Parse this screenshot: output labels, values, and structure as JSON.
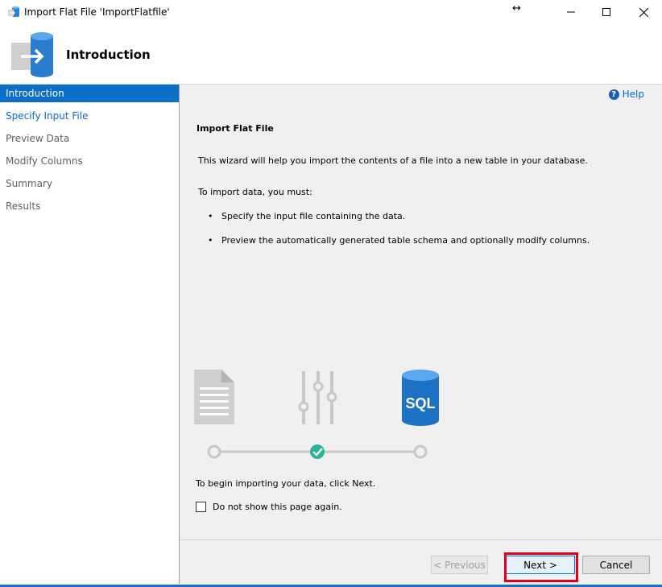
{
  "window": {
    "title": "Import Flat File 'ImportFlatfile'",
    "resize_glyph": "↔"
  },
  "header": {
    "title": "Introduction"
  },
  "nav": {
    "items": [
      {
        "label": "Introduction",
        "state": "active"
      },
      {
        "label": "Specify Input File",
        "state": "link"
      },
      {
        "label": "Preview Data",
        "state": "disabled"
      },
      {
        "label": "Modify Columns",
        "state": "disabled"
      },
      {
        "label": "Summary",
        "state": "disabled"
      },
      {
        "label": "Results",
        "state": "disabled"
      }
    ]
  },
  "content": {
    "help_label": "Help",
    "heading": "Import Flat File",
    "intro": "This wizard will help you import the contents of a file into a new table in your database.",
    "must": "To import data, you must:",
    "bullets": [
      "Specify the input file containing the data.",
      "Preview the automatically generated table schema and optionally modify columns."
    ],
    "illustration": {
      "sql_label": "SQL"
    },
    "begin_text": "To begin importing your data, click Next.",
    "checkbox_label": "Do not show this page again.",
    "checkbox_checked": false
  },
  "footer": {
    "previous_label": "< Previous",
    "next_label": "Next >",
    "cancel_label": "Cancel"
  },
  "colors": {
    "accent": "#0c6ec7",
    "highlight_box": "#e0001b",
    "teal_check": "#2bb39c"
  }
}
